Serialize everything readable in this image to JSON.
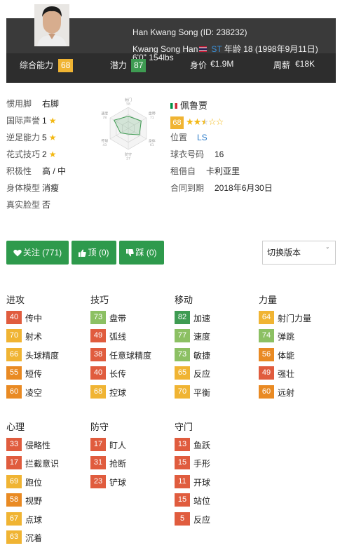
{
  "player": {
    "name_line": "Han Kwang Song (ID: 238232)",
    "short_name": "Kwang Song Han",
    "position": "ST",
    "age_line": "年龄 18 (1998年9月11日)",
    "height_weight": "6'0\" 154lbs"
  },
  "header_stats": {
    "overall_label": "综合能力",
    "overall": "68",
    "potential_label": "潜力",
    "potential": "87",
    "value_label": "身价",
    "value": "€1.9M",
    "wage_label": "周薪",
    "wage": "€18K"
  },
  "info_left": [
    {
      "label": "惯用脚",
      "value": "右脚",
      "stars": 0
    },
    {
      "label": "国际声誉",
      "value": "1",
      "stars": 1
    },
    {
      "label": "逆足能力",
      "value": "5",
      "stars": 1
    },
    {
      "label": "花式技巧",
      "value": "2",
      "stars": 1
    },
    {
      "label": "积极性",
      "value": "高 / 中",
      "stars": 0
    },
    {
      "label": "身体模型",
      "value": "消瘦",
      "stars": 0
    },
    {
      "label": "真实脸型",
      "value": "否",
      "stars": 0
    }
  ],
  "radar": {
    "labels": [
      "射门",
      "盘带",
      "身体",
      "防守",
      "传球",
      "速度"
    ],
    "values": [
      58,
      71,
      61,
      27,
      43,
      78
    ]
  },
  "club": {
    "name": "佩鲁贾",
    "rating": "68",
    "stars_filled": "★★",
    "stars_half": "★",
    "stars_empty": "☆☆",
    "position_label": "位置",
    "position": "LS",
    "jersey_label": "球衣号码",
    "jersey": "16",
    "loan_label": "租借自",
    "loan": "卡利亚里",
    "contract_label": "合同到期",
    "contract": "2018年6月30日"
  },
  "buttons": {
    "follow": "关注 (771)",
    "up": "顶 (0)",
    "down": "踩 (0)",
    "version": "切换版本"
  },
  "groups": [
    {
      "title": "进攻",
      "attrs": [
        {
          "v": "40",
          "n": "传中",
          "c": "#e05c3e"
        },
        {
          "v": "70",
          "n": "射术",
          "c": "#f0b433"
        },
        {
          "v": "66",
          "n": "头球精度",
          "c": "#f0b433"
        },
        {
          "v": "55",
          "n": "短传",
          "c": "#e98a23"
        },
        {
          "v": "60",
          "n": "凌空",
          "c": "#e98a23"
        }
      ]
    },
    {
      "title": "技巧",
      "attrs": [
        {
          "v": "73",
          "n": "盘带",
          "c": "#8cc063"
        },
        {
          "v": "49",
          "n": "弧线",
          "c": "#e05c3e"
        },
        {
          "v": "38",
          "n": "任意球精度",
          "c": "#e05c3e"
        },
        {
          "v": "40",
          "n": "长传",
          "c": "#e05c3e"
        },
        {
          "v": "68",
          "n": "控球",
          "c": "#f0b433"
        }
      ]
    },
    {
      "title": "移动",
      "attrs": [
        {
          "v": "82",
          "n": "加速",
          "c": "#3e9b52"
        },
        {
          "v": "77",
          "n": "速度",
          "c": "#8cc063"
        },
        {
          "v": "73",
          "n": "敏捷",
          "c": "#8cc063"
        },
        {
          "v": "65",
          "n": "反应",
          "c": "#f0b433"
        },
        {
          "v": "70",
          "n": "平衡",
          "c": "#f0b433"
        }
      ]
    },
    {
      "title": "力量",
      "attrs": [
        {
          "v": "64",
          "n": "射门力量",
          "c": "#f0b433"
        },
        {
          "v": "74",
          "n": "弹跳",
          "c": "#8cc063"
        },
        {
          "v": "56",
          "n": "体能",
          "c": "#e98a23"
        },
        {
          "v": "49",
          "n": "强壮",
          "c": "#e05c3e"
        },
        {
          "v": "60",
          "n": "远射",
          "c": "#e98a23"
        }
      ]
    },
    {
      "title": "心理",
      "attrs": [
        {
          "v": "33",
          "n": "侵略性",
          "c": "#e05c3e"
        },
        {
          "v": "17",
          "n": "拦截意识",
          "c": "#e05c3e"
        },
        {
          "v": "69",
          "n": "跑位",
          "c": "#f0b433"
        },
        {
          "v": "58",
          "n": "视野",
          "c": "#e98a23"
        },
        {
          "v": "67",
          "n": "点球",
          "c": "#f0b433"
        },
        {
          "v": "63",
          "n": "沉着",
          "c": "#f0b433"
        }
      ]
    },
    {
      "title": "防守",
      "attrs": [
        {
          "v": "17",
          "n": "盯人",
          "c": "#e05c3e"
        },
        {
          "v": "31",
          "n": "抢断",
          "c": "#e05c3e"
        },
        {
          "v": "23",
          "n": "铲球",
          "c": "#e05c3e"
        }
      ]
    },
    {
      "title": "守门",
      "attrs": [
        {
          "v": "13",
          "n": "鱼跃",
          "c": "#e05c3e"
        },
        {
          "v": "15",
          "n": "手形",
          "c": "#e05c3e"
        },
        {
          "v": "11",
          "n": "开球",
          "c": "#e05c3e"
        },
        {
          "v": "15",
          "n": "站位",
          "c": "#e05c3e"
        },
        {
          "v": "5",
          "n": "反应",
          "c": "#e05c3e"
        }
      ]
    }
  ],
  "colors": {
    "header_bg": "#2d2d2d",
    "overall_badge": "#f0b433",
    "potential_badge": "#3e9b52",
    "button_green": "#2e9a4c",
    "radar_stroke": "#3e9b52"
  }
}
